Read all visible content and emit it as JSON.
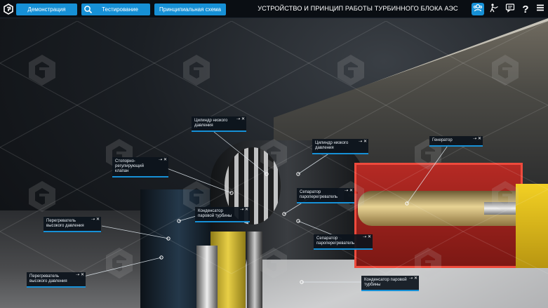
{
  "topbar": {
    "title": "УСТРОЙСТВО И ПРИНЦИП РАБОТЫ ТУРБИННОГО БЛОКА АЭС",
    "buttons": [
      {
        "label": "Демонстрация"
      },
      {
        "label": "Тестирование",
        "icon": "search-icon"
      },
      {
        "label": "Принципиальная схема"
      }
    ],
    "tools": [
      "user-group-icon",
      "person-pointer-icon",
      "chat-icon",
      "help-icon",
      "menu-icon"
    ],
    "help_glyph": "?",
    "accent": "#1690d6"
  },
  "callouts": [
    {
      "label": "Цилиндр низкого давления",
      "controls": "⇢ ✕"
    },
    {
      "label": "Цилиндр низкого давления",
      "controls": "⇢ ✕"
    },
    {
      "label": "Генератор",
      "controls": "⇢ ✕"
    },
    {
      "label": "Стопорно-регулирующий клапан",
      "controls": "⇢ ✕"
    },
    {
      "label": "Сепаратор пароперегреватель",
      "controls": "⇢ ✕"
    },
    {
      "label": "Конденсатор паровой турбины",
      "controls": "⇢ ✕"
    },
    {
      "label": "Перегреватель высокого давления",
      "controls": "⇢ ✕"
    },
    {
      "label": "Сепаратор пароперегреватель",
      "controls": "⇢ ✕"
    },
    {
      "label": "Перегреватель высокого давления",
      "controls": "⇢ ✕"
    },
    {
      "label": "Конденсатор паровой турбины",
      "controls": "⇢ ✕"
    }
  ]
}
